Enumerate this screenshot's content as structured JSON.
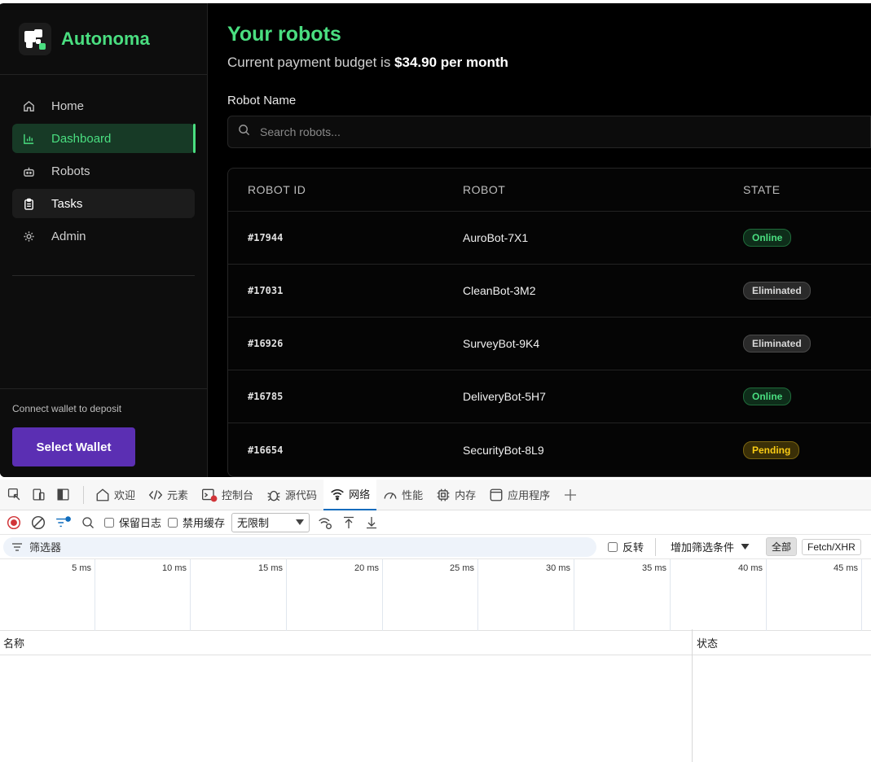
{
  "app": {
    "brand": "Autonoma",
    "nav": [
      {
        "label": "Home",
        "icon": "home-icon"
      },
      {
        "label": "Dashboard",
        "icon": "chart-icon"
      },
      {
        "label": "Robots",
        "icon": "robot-icon"
      },
      {
        "label": "Tasks",
        "icon": "clipboard-icon"
      },
      {
        "label": "Admin",
        "icon": "gear-icon"
      }
    ],
    "footer": {
      "hint": "Connect wallet to deposit",
      "button": "Select Wallet"
    }
  },
  "main": {
    "title": "Your robots",
    "subtitle_prefix": "Current payment budget is ",
    "subtitle_amount": "$34.90 per month",
    "field_label": "Robot Name",
    "search_placeholder": "Search robots...",
    "columns": [
      "ROBOT ID",
      "ROBOT",
      "STATE"
    ],
    "rows": [
      {
        "id": "#17944",
        "name": "AuroBot-7X1",
        "state": "Online",
        "kind": "online"
      },
      {
        "id": "#17031",
        "name": "CleanBot-3M2",
        "state": "Eliminated",
        "kind": "elim"
      },
      {
        "id": "#16926",
        "name": "SurveyBot-9K4",
        "state": "Eliminated",
        "kind": "elim"
      },
      {
        "id": "#16785",
        "name": "DeliveryBot-5H7",
        "state": "Online",
        "kind": "online"
      },
      {
        "id": "#16654",
        "name": "SecurityBot-8L9",
        "state": "Pending",
        "kind": "pending"
      }
    ]
  },
  "devtools": {
    "tabs": [
      "欢迎",
      "元素",
      "控制台",
      "源代码",
      "网络",
      "性能",
      "内存",
      "应用程序"
    ],
    "active_tab": "网络",
    "preserve_log": "保留日志",
    "disable_cache": "禁用缓存",
    "throttle": "无限制",
    "filter_placeholder": "筛选器",
    "invert": "反转",
    "more_filters": "增加筛选条件",
    "chip_all": "全部",
    "chip_fetch": "Fetch/XHR",
    "ticks": [
      "5 ms",
      "10 ms",
      "15 ms",
      "20 ms",
      "25 ms",
      "30 ms",
      "35 ms",
      "40 ms",
      "45 ms"
    ],
    "col_name": "名称",
    "col_status": "状态"
  }
}
